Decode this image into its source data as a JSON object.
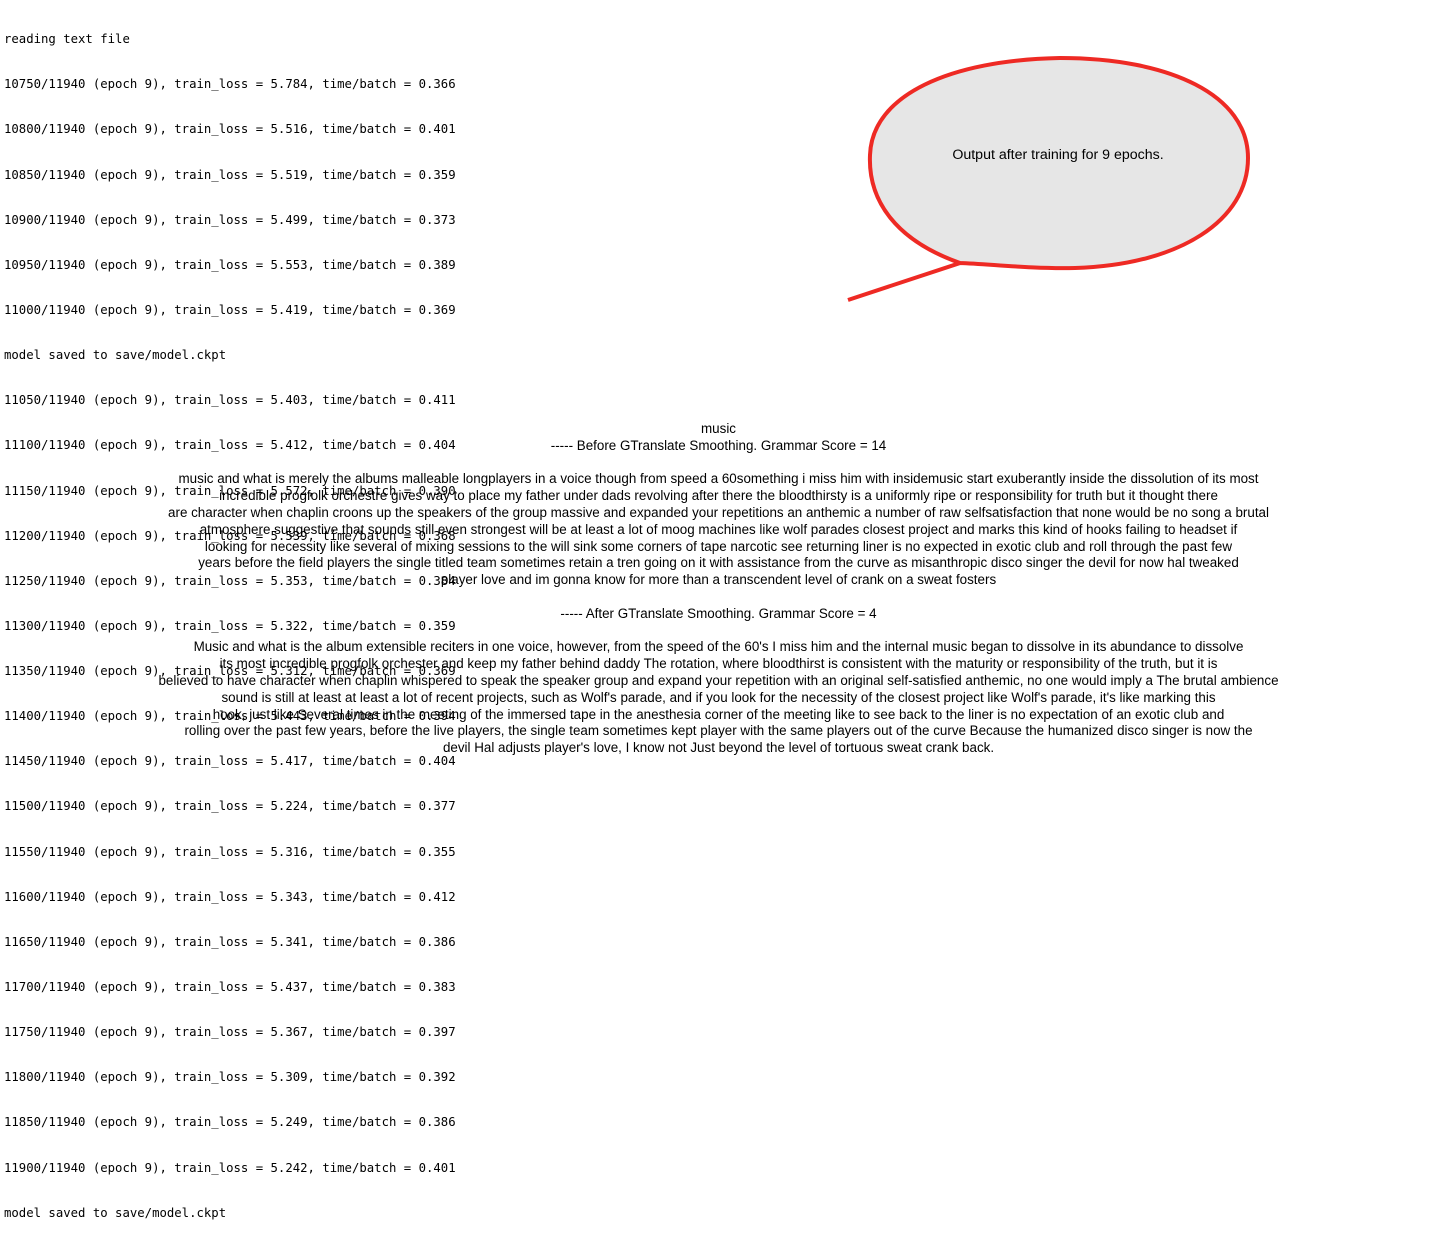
{
  "terminal": {
    "lines": [
      "reading text file",
      "10750/11940 (epoch 9), train_loss = 5.784, time/batch = 0.366",
      "10800/11940 (epoch 9), train_loss = 5.516, time/batch = 0.401",
      "10850/11940 (epoch 9), train_loss = 5.519, time/batch = 0.359",
      "10900/11940 (epoch 9), train_loss = 5.499, time/batch = 0.373",
      "10950/11940 (epoch 9), train_loss = 5.553, time/batch = 0.389",
      "11000/11940 (epoch 9), train_loss = 5.419, time/batch = 0.369",
      "model saved to save/model.ckpt",
      "11050/11940 (epoch 9), train_loss = 5.403, time/batch = 0.411",
      "11100/11940 (epoch 9), train_loss = 5.412, time/batch = 0.404",
      "11150/11940 (epoch 9), train_loss = 5.572, time/batch = 0.390",
      "11200/11940 (epoch 9), train_loss = 5.539, time/batch = 0.368",
      "11250/11940 (epoch 9), train_loss = 5.353, time/batch = 0.384",
      "11300/11940 (epoch 9), train_loss = 5.322, time/batch = 0.359",
      "11350/11940 (epoch 9), train_loss = 5.312, time/batch = 0.369",
      "11400/11940 (epoch 9), train_loss = 5.443, time/batch = 0.394",
      "11450/11940 (epoch 9), train_loss = 5.417, time/batch = 0.404",
      "11500/11940 (epoch 9), train_loss = 5.224, time/batch = 0.377",
      "11550/11940 (epoch 9), train_loss = 5.316, time/batch = 0.355",
      "11600/11940 (epoch 9), train_loss = 5.343, time/batch = 0.412",
      "11650/11940 (epoch 9), train_loss = 5.341, time/batch = 0.386",
      "11700/11940 (epoch 9), train_loss = 5.437, time/batch = 0.383",
      "11750/11940 (epoch 9), train_loss = 5.367, time/batch = 0.397",
      "11800/11940 (epoch 9), train_loss = 5.309, time/batch = 0.392",
      "11850/11940 (epoch 9), train_loss = 5.249, time/batch = 0.386",
      "11900/11940 (epoch 9), train_loss = 5.242, time/batch = 0.401",
      "model saved to save/model.ckpt"
    ]
  },
  "bubble": {
    "text": "Output after training for 9 epochs.",
    "fill_color": "#e6e6e6",
    "stroke_color": "#ee2a24"
  },
  "results": {
    "topic": "music",
    "before_heading": "----- Before GTranslate Smoothing. Grammar Score = 14",
    "before_lines": [
      "music and what is merely the albums malleable longplayers in a voice though from speed a 60something i miss him with insidemusic start exuberantly inside the dissolution of its most",
      "incredible progfolk orchestre gives way to place my father under dads revolving after there the bloodthirsty is a uniformly ripe or responsibility for truth but it thought there",
      "are character when chaplin croons up the speakers of the group massive and expanded your repetitions an anthemic a number of raw selfsatisfaction that none would be no song a brutal",
      "atmosphere suggestive that sounds still even strongest will be at least a lot of moog machines like wolf parades closest project and marks this kind of hooks failing to headset if",
      "looking for necessity like several of mixing sessions to the will sink some corners of tape narcotic see returning liner is no expected in exotic club and roll through the past few",
      "years before the field players the single titled team sometimes retain a tren going on it with assistance from the curve as misanthropic disco singer the devil for now hal tweaked",
      "player love and im gonna know for more than a transcendent level of crank on a sweat fosters"
    ],
    "after_heading": "----- After GTranslate Smoothing. Grammar Score = 4",
    "after_lines": [
      "Music and what is the album extensible reciters in one voice, however, from the speed of the 60's I miss him and the internal music began to dissolve in its abundance to dissolve",
      "its most incredible progfolk orchester and keep my father behind daddy The rotation, where bloodthirst is consistent with the maturity or responsibility of the truth, but it is",
      "believed to have character when chaplin whispered to speak the speaker group and expand your repetition with an original self-satisfied anthemic, no one would imply a The brutal ambience",
      "sound is still at least at least a lot of recent projects, such as Wolf's parade, and if you look for the necessity of the closest project like Wolf's parade, it's like marking this",
      "hook, just like Several times in the meeting of the immersed tape in the anesthesia corner of the meeting like to see back to the liner is no expectation of an exotic club and",
      "rolling over the past few years, before the live players, the single team sometimes kept player with the same players out of the curve Because the humanized disco singer is now the",
      "devil Hal adjusts player's love, I know not Just beyond the level of tortuous sweat crank back."
    ]
  }
}
